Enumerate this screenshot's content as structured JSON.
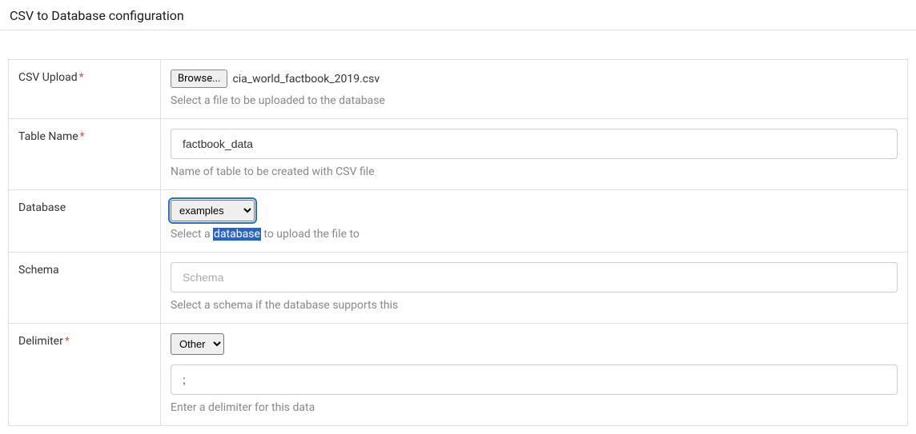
{
  "page": {
    "title": "CSV to Database configuration"
  },
  "fields": {
    "csv_upload": {
      "label": "CSV Upload",
      "required_marker": "*",
      "browse_button": "Browse...",
      "filename": "cia_world_factbook_2019.csv",
      "help": "Select a file to be uploaded to the database"
    },
    "table_name": {
      "label": "Table Name",
      "required_marker": "*",
      "value": "factbook_data",
      "help": "Name of table to be created with CSV file"
    },
    "database": {
      "label": "Database",
      "selected": "examples",
      "help_pre": "Select a ",
      "help_highlight": "database",
      "help_post": " to upload the file to"
    },
    "schema": {
      "label": "Schema",
      "placeholder": "Schema",
      "value": "",
      "help": "Select a schema if the database supports this"
    },
    "delimiter": {
      "label": "Delimiter",
      "required_marker": "*",
      "selected": "Other",
      "custom_value": ";",
      "help": "Enter a delimiter for this data"
    }
  }
}
